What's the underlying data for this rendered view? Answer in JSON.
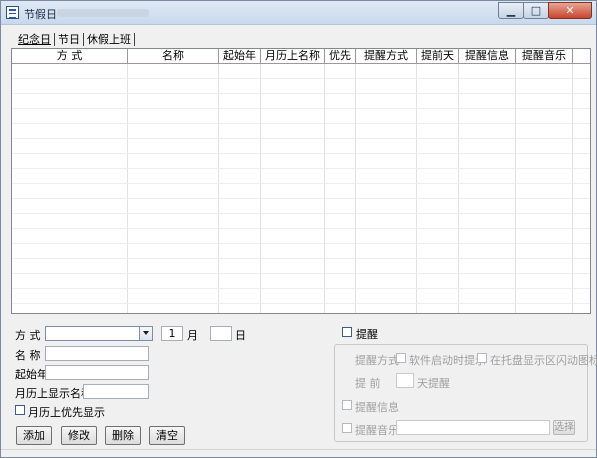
{
  "window": {
    "title": "节假日",
    "controls": {
      "minimize": "▁",
      "maximize": "□",
      "close": "✕"
    }
  },
  "tabs": [
    {
      "label": "纪念日",
      "active": true
    },
    {
      "label": "节日",
      "active": false
    },
    {
      "label": "休假上班",
      "active": false
    }
  ],
  "table": {
    "columns": [
      "方 式",
      "名称",
      "起始年",
      "月历上名称",
      "优先",
      "提醒方式",
      "提前天",
      "提醒信息",
      "提醒音乐"
    ],
    "rows": []
  },
  "form": {
    "method_label": "方  式",
    "method_value": "",
    "month_value": "1",
    "month_label": "月",
    "day_value": "",
    "day_label": "日",
    "name_label": "名  称",
    "name_value": "",
    "start_year_label": "起始年",
    "start_year_value": "",
    "calendar_name_label": "月历上显示名称",
    "calendar_name_value": "",
    "priority_label": "月历上优先显示",
    "priority_checked": false
  },
  "buttons": {
    "add": "添加",
    "modify": "修改",
    "delete": "删除",
    "clear": "清空"
  },
  "reminder": {
    "enable_label": "提醒",
    "enabled": false,
    "mode_label": "提醒方式",
    "startup_label": "软件启动时提示",
    "tray_label": "在托盘显示区闪动图标",
    "advance_label": "提  前",
    "advance_value": "",
    "days_label": "天提醒",
    "info_label": "提醒信息",
    "music_label": "提醒音乐",
    "music_value": "",
    "choose_button": "选择"
  }
}
